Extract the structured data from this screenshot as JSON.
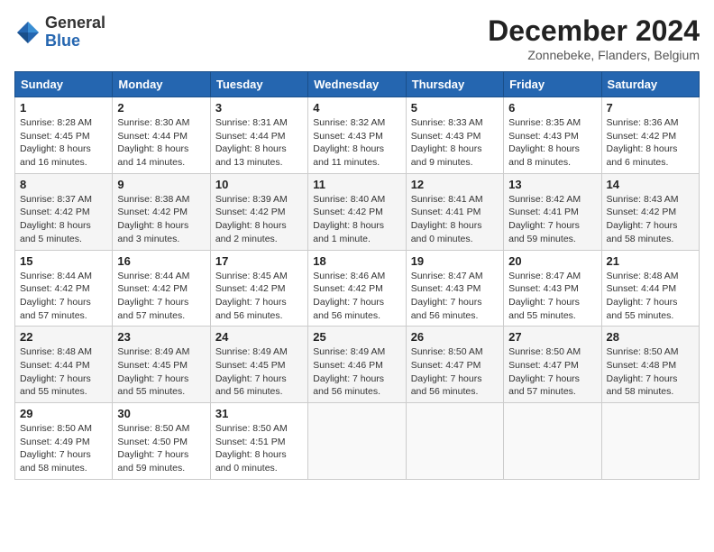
{
  "header": {
    "logo_general": "General",
    "logo_blue": "Blue",
    "month_title": "December 2024",
    "subtitle": "Zonnebeke, Flanders, Belgium"
  },
  "weekdays": [
    "Sunday",
    "Monday",
    "Tuesday",
    "Wednesday",
    "Thursday",
    "Friday",
    "Saturday"
  ],
  "weeks": [
    [
      {
        "day": "1",
        "sunrise": "Sunrise: 8:28 AM",
        "sunset": "Sunset: 4:45 PM",
        "daylight": "Daylight: 8 hours and 16 minutes."
      },
      {
        "day": "2",
        "sunrise": "Sunrise: 8:30 AM",
        "sunset": "Sunset: 4:44 PM",
        "daylight": "Daylight: 8 hours and 14 minutes."
      },
      {
        "day": "3",
        "sunrise": "Sunrise: 8:31 AM",
        "sunset": "Sunset: 4:44 PM",
        "daylight": "Daylight: 8 hours and 13 minutes."
      },
      {
        "day": "4",
        "sunrise": "Sunrise: 8:32 AM",
        "sunset": "Sunset: 4:43 PM",
        "daylight": "Daylight: 8 hours and 11 minutes."
      },
      {
        "day": "5",
        "sunrise": "Sunrise: 8:33 AM",
        "sunset": "Sunset: 4:43 PM",
        "daylight": "Daylight: 8 hours and 9 minutes."
      },
      {
        "day": "6",
        "sunrise": "Sunrise: 8:35 AM",
        "sunset": "Sunset: 4:43 PM",
        "daylight": "Daylight: 8 hours and 8 minutes."
      },
      {
        "day": "7",
        "sunrise": "Sunrise: 8:36 AM",
        "sunset": "Sunset: 4:42 PM",
        "daylight": "Daylight: 8 hours and 6 minutes."
      }
    ],
    [
      {
        "day": "8",
        "sunrise": "Sunrise: 8:37 AM",
        "sunset": "Sunset: 4:42 PM",
        "daylight": "Daylight: 8 hours and 5 minutes."
      },
      {
        "day": "9",
        "sunrise": "Sunrise: 8:38 AM",
        "sunset": "Sunset: 4:42 PM",
        "daylight": "Daylight: 8 hours and 3 minutes."
      },
      {
        "day": "10",
        "sunrise": "Sunrise: 8:39 AM",
        "sunset": "Sunset: 4:42 PM",
        "daylight": "Daylight: 8 hours and 2 minutes."
      },
      {
        "day": "11",
        "sunrise": "Sunrise: 8:40 AM",
        "sunset": "Sunset: 4:42 PM",
        "daylight": "Daylight: 8 hours and 1 minute."
      },
      {
        "day": "12",
        "sunrise": "Sunrise: 8:41 AM",
        "sunset": "Sunset: 4:41 PM",
        "daylight": "Daylight: 8 hours and 0 minutes."
      },
      {
        "day": "13",
        "sunrise": "Sunrise: 8:42 AM",
        "sunset": "Sunset: 4:41 PM",
        "daylight": "Daylight: 7 hours and 59 minutes."
      },
      {
        "day": "14",
        "sunrise": "Sunrise: 8:43 AM",
        "sunset": "Sunset: 4:42 PM",
        "daylight": "Daylight: 7 hours and 58 minutes."
      }
    ],
    [
      {
        "day": "15",
        "sunrise": "Sunrise: 8:44 AM",
        "sunset": "Sunset: 4:42 PM",
        "daylight": "Daylight: 7 hours and 57 minutes."
      },
      {
        "day": "16",
        "sunrise": "Sunrise: 8:44 AM",
        "sunset": "Sunset: 4:42 PM",
        "daylight": "Daylight: 7 hours and 57 minutes."
      },
      {
        "day": "17",
        "sunrise": "Sunrise: 8:45 AM",
        "sunset": "Sunset: 4:42 PM",
        "daylight": "Daylight: 7 hours and 56 minutes."
      },
      {
        "day": "18",
        "sunrise": "Sunrise: 8:46 AM",
        "sunset": "Sunset: 4:42 PM",
        "daylight": "Daylight: 7 hours and 56 minutes."
      },
      {
        "day": "19",
        "sunrise": "Sunrise: 8:47 AM",
        "sunset": "Sunset: 4:43 PM",
        "daylight": "Daylight: 7 hours and 56 minutes."
      },
      {
        "day": "20",
        "sunrise": "Sunrise: 8:47 AM",
        "sunset": "Sunset: 4:43 PM",
        "daylight": "Daylight: 7 hours and 55 minutes."
      },
      {
        "day": "21",
        "sunrise": "Sunrise: 8:48 AM",
        "sunset": "Sunset: 4:44 PM",
        "daylight": "Daylight: 7 hours and 55 minutes."
      }
    ],
    [
      {
        "day": "22",
        "sunrise": "Sunrise: 8:48 AM",
        "sunset": "Sunset: 4:44 PM",
        "daylight": "Daylight: 7 hours and 55 minutes."
      },
      {
        "day": "23",
        "sunrise": "Sunrise: 8:49 AM",
        "sunset": "Sunset: 4:45 PM",
        "daylight": "Daylight: 7 hours and 55 minutes."
      },
      {
        "day": "24",
        "sunrise": "Sunrise: 8:49 AM",
        "sunset": "Sunset: 4:45 PM",
        "daylight": "Daylight: 7 hours and 56 minutes."
      },
      {
        "day": "25",
        "sunrise": "Sunrise: 8:49 AM",
        "sunset": "Sunset: 4:46 PM",
        "daylight": "Daylight: 7 hours and 56 minutes."
      },
      {
        "day": "26",
        "sunrise": "Sunrise: 8:50 AM",
        "sunset": "Sunset: 4:47 PM",
        "daylight": "Daylight: 7 hours and 56 minutes."
      },
      {
        "day": "27",
        "sunrise": "Sunrise: 8:50 AM",
        "sunset": "Sunset: 4:47 PM",
        "daylight": "Daylight: 7 hours and 57 minutes."
      },
      {
        "day": "28",
        "sunrise": "Sunrise: 8:50 AM",
        "sunset": "Sunset: 4:48 PM",
        "daylight": "Daylight: 7 hours and 58 minutes."
      }
    ],
    [
      {
        "day": "29",
        "sunrise": "Sunrise: 8:50 AM",
        "sunset": "Sunset: 4:49 PM",
        "daylight": "Daylight: 7 hours and 58 minutes."
      },
      {
        "day": "30",
        "sunrise": "Sunrise: 8:50 AM",
        "sunset": "Sunset: 4:50 PM",
        "daylight": "Daylight: 7 hours and 59 minutes."
      },
      {
        "day": "31",
        "sunrise": "Sunrise: 8:50 AM",
        "sunset": "Sunset: 4:51 PM",
        "daylight": "Daylight: 8 hours and 0 minutes."
      },
      null,
      null,
      null,
      null
    ]
  ]
}
